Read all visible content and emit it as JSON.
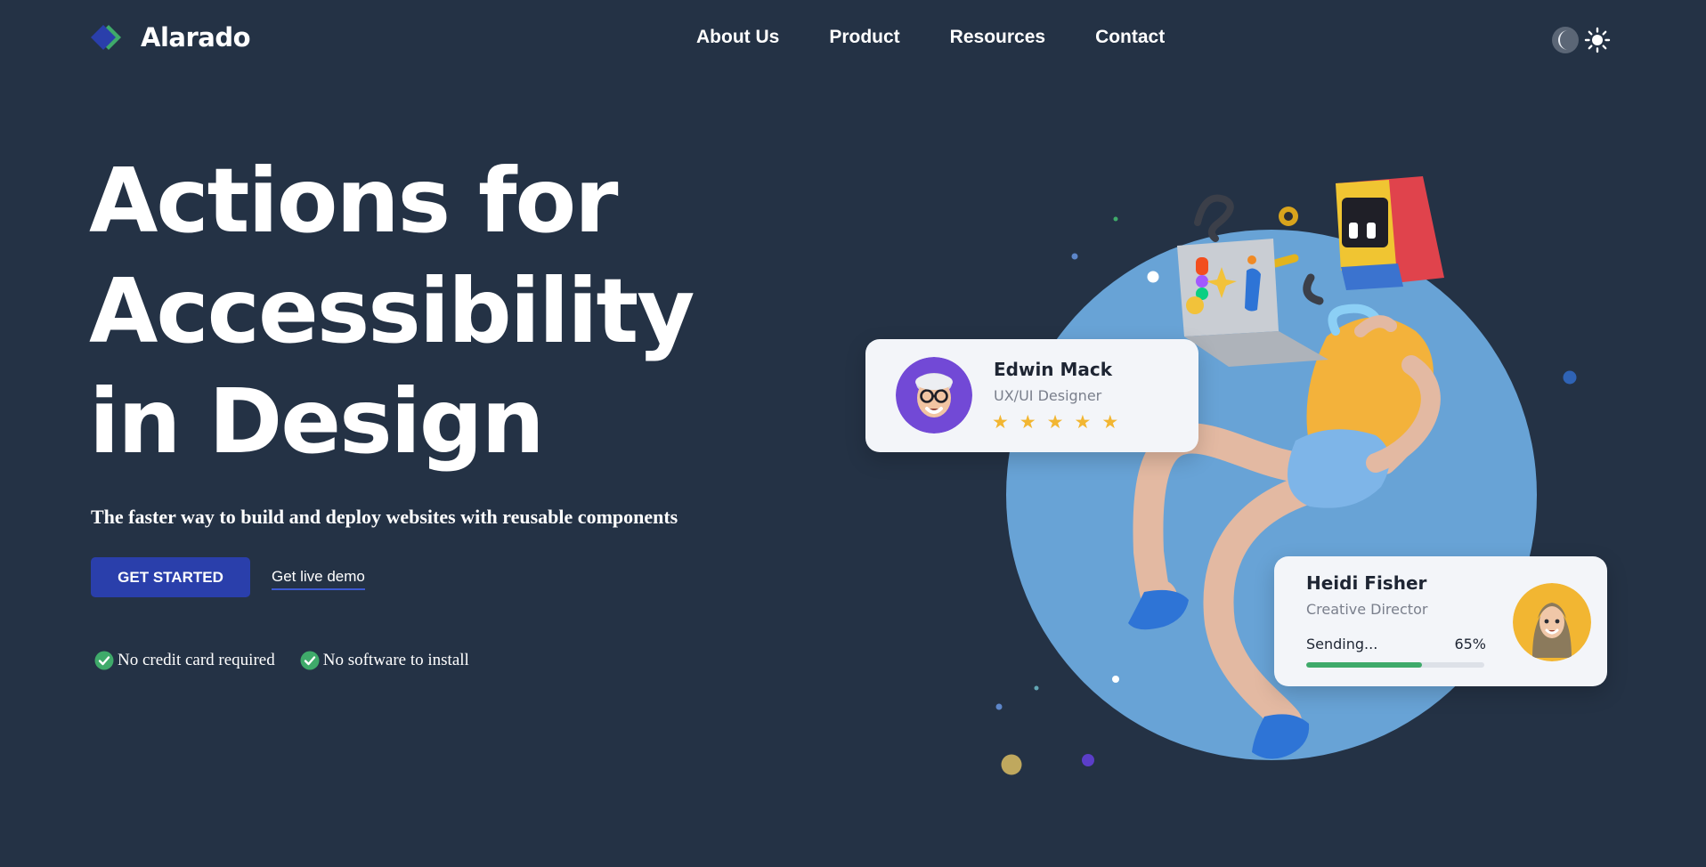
{
  "brand": {
    "name": "Alarado",
    "colors": {
      "mark_primary": "#2a3fab",
      "mark_secondary": "#3faa6a"
    }
  },
  "nav": {
    "items": [
      {
        "label": "About Us"
      },
      {
        "label": "Product"
      },
      {
        "label": "Resources"
      },
      {
        "label": "Contact"
      }
    ]
  },
  "theme_toggle": {
    "dark_icon": "moon-icon",
    "light_icon": "sun-icon"
  },
  "hero": {
    "headline_lines": [
      "Actions for",
      "Accessibility",
      "in Design"
    ],
    "subtitle": "The faster way to build and deploy websites with reusable components",
    "primary_cta": "GET STARTED",
    "secondary_cta": "Get live demo",
    "perks": [
      {
        "icon": "check-circle-icon",
        "label": "No credit card required"
      },
      {
        "icon": "check-circle-icon",
        "label": "No software to install"
      }
    ]
  },
  "cards": {
    "profile": {
      "name": "Edwin Mack",
      "role": "UX/UI Designer",
      "rating": 5,
      "star_glyph": "★"
    },
    "transfer": {
      "name": "Heidi Fisher",
      "role": "Creative Director",
      "status": "Sending...",
      "progress_text": "65%",
      "progress": 0.65
    }
  },
  "colors": {
    "background": "#243245",
    "accent": "#2a3fab",
    "circle": "#68a3d6",
    "success": "#3faa6a",
    "star": "#f2b632"
  }
}
